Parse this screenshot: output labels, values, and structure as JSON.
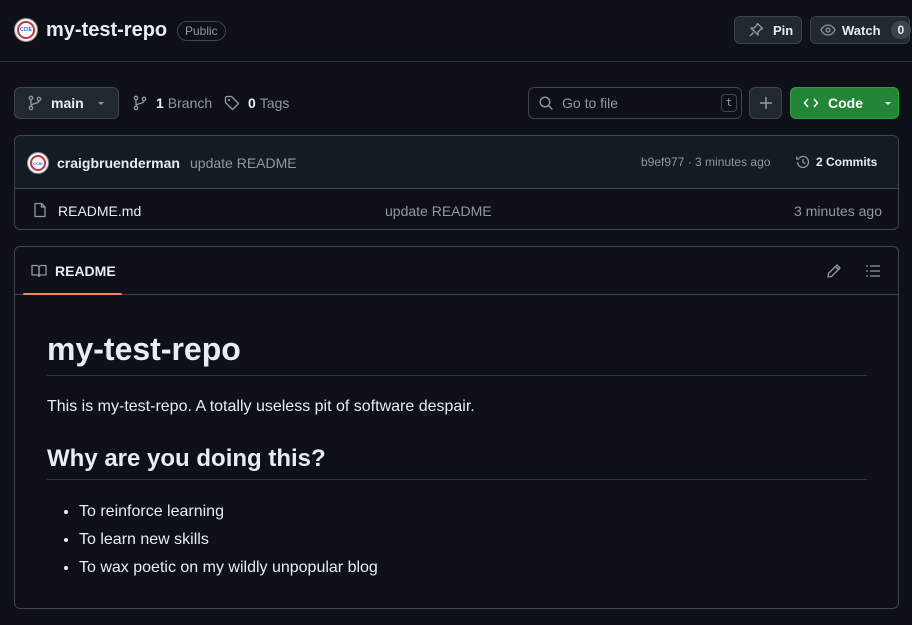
{
  "header": {
    "repo_name": "my-test-repo",
    "visibility": "Public",
    "pin_label": "Pin",
    "watch_label": "Watch",
    "watch_count": "0"
  },
  "toolbar": {
    "branch": "main",
    "branch_count": "1",
    "branch_label": "Branch",
    "tag_count": "0",
    "tag_label": "Tags",
    "search_placeholder": "Go to file",
    "search_shortcut": "t",
    "code_label": "Code"
  },
  "latest_commit": {
    "author": "craigbruenderman",
    "message": "update README",
    "hash_time": "b9ef977 · 3 minutes ago",
    "commits_label": "2 Commits"
  },
  "files": [
    {
      "name": "README.md",
      "message": "update README",
      "time": "3 minutes ago"
    }
  ],
  "readme": {
    "tab_label": "README",
    "title": "my-test-repo",
    "intro": "This is my-test-repo. A totally useless pit of software despair.",
    "heading": "Why are you doing this?",
    "bullets": [
      "To reinforce learning",
      "To learn new skills",
      "To wax poetic on my wildly unpopular blog"
    ]
  },
  "colors": {
    "background": "#0d1117",
    "border": "#3d444d",
    "primary_button": "#238636",
    "tab_accent": "#f78166"
  }
}
